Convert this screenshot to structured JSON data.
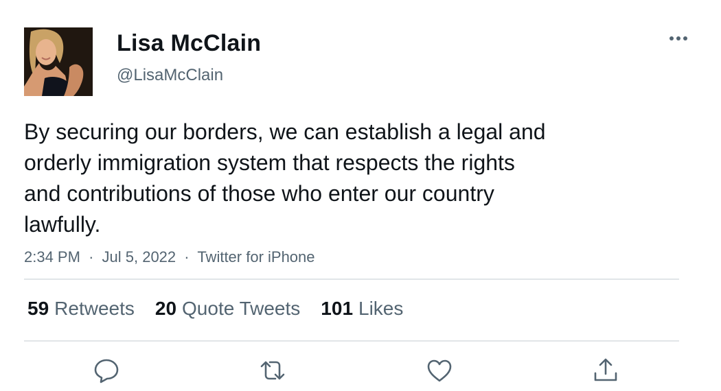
{
  "author": {
    "display_name": "Lisa McClain",
    "handle": "@LisaMcClain",
    "avatar": "profile-photo"
  },
  "tweet": {
    "text": "By securing our borders, we can establish a legal and\norderly immigration system that respects the rights\nand contributions of those who enter our country\nlawfully.",
    "time": "2:34 PM",
    "date": "Jul 5, 2022",
    "source": "Twitter for iPhone",
    "separator": "·"
  },
  "stats": {
    "retweets_count": "59",
    "retweets_label": "Retweets",
    "quotes_count": "20",
    "quotes_label": "Quote Tweets",
    "likes_count": "101",
    "likes_label": "Likes"
  },
  "actions": {
    "reply": "reply-icon",
    "retweet": "retweet-icon",
    "like": "heart-icon",
    "share": "share-icon",
    "more": "more-icon"
  },
  "colors": {
    "text_primary": "#0f1419",
    "text_secondary": "#536471",
    "divider": "#e1e5e8",
    "icon": "#536471"
  }
}
